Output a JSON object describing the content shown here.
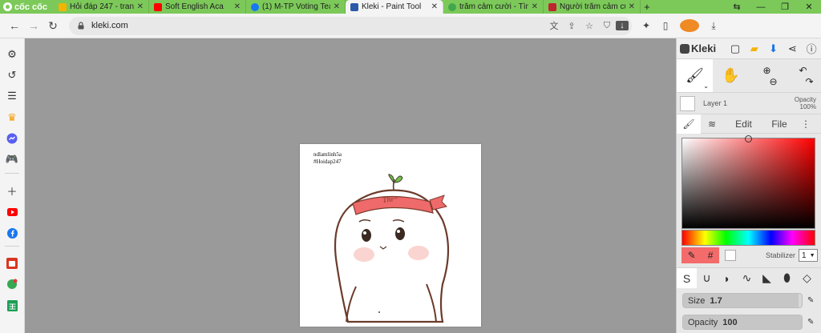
{
  "browser": {
    "brand": "cốc cốc",
    "tabs": [
      {
        "title": "Hỏi đáp 247 - trang",
        "favicon_color": "#f2b400"
      },
      {
        "title": "Soft English Aca",
        "favicon_color": "#ff0000"
      },
      {
        "title": "(1) M-TP Voting Tea",
        "favicon_color": "#1877f2"
      },
      {
        "title": "Kleki - Paint Tool",
        "favicon_color": "#2a5aa8",
        "active": true
      },
      {
        "title": "trăm cảm cười - Tìm",
        "favicon_color": "#42a74a"
      },
      {
        "title": "Người trăm cảm cưới",
        "favicon_color": "#c0262d"
      }
    ],
    "new_tab": "+",
    "url": "kleki.com",
    "accent_color": "#7cc95a"
  },
  "sidebar": {
    "icons": [
      "gear-icon",
      "history-icon",
      "list-icon",
      "crown-icon",
      "messenger-icon",
      "game-icon",
      "plus-icon",
      "youtube-icon",
      "facebook-icon",
      "shopee-icon",
      "chat-icon",
      "sheets-icon"
    ]
  },
  "canvas": {
    "watermark_line1": "ndlamlinh5a",
    "watermark_line2": "#Hoidap247",
    "headband_text": "Thi~"
  },
  "kleki": {
    "app_name": "Kleki",
    "layer_name": "Layer 1",
    "layer_opacity_label": "Opacity",
    "layer_opacity_value": "100%",
    "tab_edit": "Edit",
    "tab_file": "File",
    "hash_label": "#",
    "stabilizer_label": "Stabilizer",
    "stabilizer_value": "1",
    "size_label": "Size",
    "size_value": "1.7",
    "opacity_label": "Opacity",
    "opacity_value": "100",
    "size_fraction": 0.97,
    "opacity_fraction": 1.0,
    "brush_color": "#f36b6b"
  }
}
